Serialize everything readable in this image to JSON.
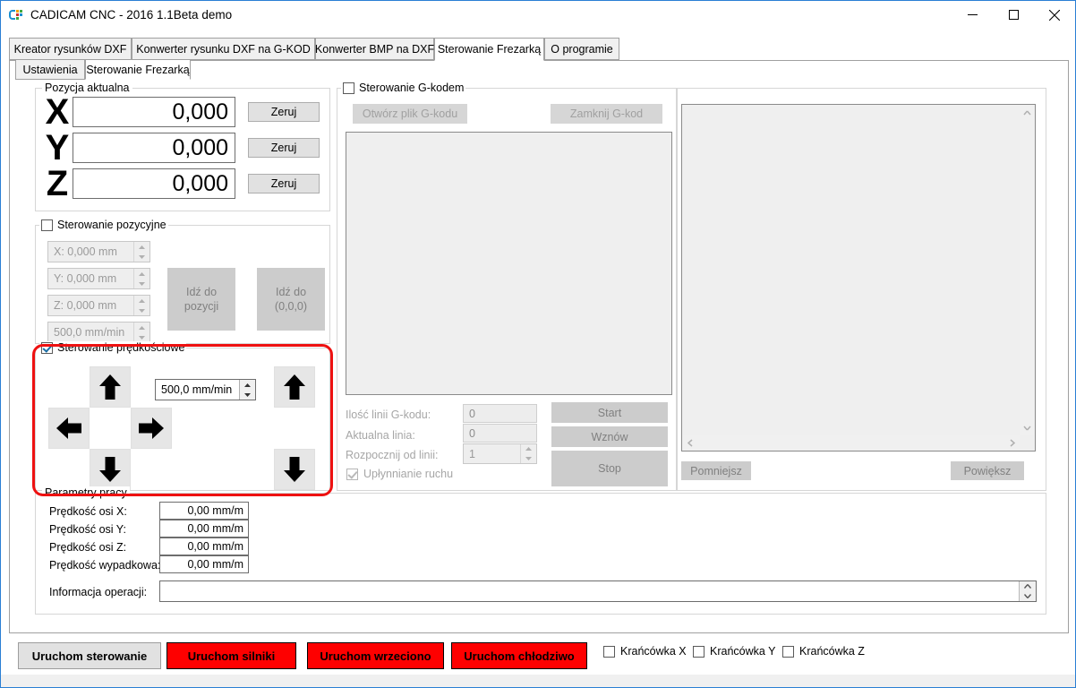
{
  "window": {
    "title": "CADICAM CNC - 2016 1.1Beta demo",
    "minimize": "minimize-icon",
    "maximize": "maximize-icon",
    "close": "close-icon"
  },
  "tabs": [
    {
      "label": "Kreator rysunków DXF",
      "active": false
    },
    {
      "label": "Konwerter rysunku DXF na G-KOD",
      "active": false
    },
    {
      "label": "Konwerter BMP na DXF",
      "active": false
    },
    {
      "label": "Sterowanie Frezarką",
      "active": true
    },
    {
      "label": "O programie",
      "active": false
    }
  ],
  "inner_tabs": [
    {
      "label": "Ustawienia",
      "active": false
    },
    {
      "label": "Sterowanie Frezarką",
      "active": true
    }
  ],
  "position_group": {
    "title": "Pozycja aktualna",
    "axes": [
      {
        "letter": "X",
        "value": "0,000",
        "zero_button": "Zeruj"
      },
      {
        "letter": "Y",
        "value": "0,000",
        "zero_button": "Zeruj"
      },
      {
        "letter": "Z",
        "value": "0,000",
        "zero_button": "Zeruj"
      }
    ]
  },
  "positional_control": {
    "title": "Sterowanie pozycyjne",
    "enabled": false,
    "fields": [
      {
        "value": "X: 0,000 mm"
      },
      {
        "value": "Y: 0,000 mm"
      },
      {
        "value": "Z: 0,000 mm"
      },
      {
        "value": "500,0 mm/min"
      }
    ],
    "goto_position_button": "Idź do\npozycji",
    "goto_position_line1": "Idź do",
    "goto_position_line2": "pozycji",
    "goto_zero_line1": "Idź do",
    "goto_zero_line2": "(0,0,0)"
  },
  "speed_control": {
    "title": "Sterowanie prędkościowe",
    "enabled": true,
    "feedrate": "500,0 mm/min",
    "highlighted": true,
    "highlight_color": "#ee1111",
    "buttons": [
      {
        "name": "jog-y-plus",
        "icon": "arrow-up-icon"
      },
      {
        "name": "jog-x-minus",
        "icon": "arrow-left-icon"
      },
      {
        "name": "jog-x-plus",
        "icon": "arrow-right-icon"
      },
      {
        "name": "jog-y-minus",
        "icon": "arrow-down-icon"
      },
      {
        "name": "jog-z-plus",
        "icon": "arrow-up-icon"
      },
      {
        "name": "jog-z-minus",
        "icon": "arrow-down-icon"
      }
    ]
  },
  "work_params": {
    "title": "Parametry pracy",
    "rows": [
      {
        "label": "Prędkość osi X:",
        "value": "0,00 mm/m"
      },
      {
        "label": "Prędkość osi Y:",
        "value": "0,00 mm/m"
      },
      {
        "label": "Prędkość osi Z:",
        "value": "0,00 mm/m"
      },
      {
        "label": "Prędkość wypadkowa:",
        "value": "0,00 mm/m"
      }
    ],
    "info_label": "Informacja operacji:",
    "info_value": ""
  },
  "gcode_control": {
    "title": "Sterowanie G-kodem",
    "enabled": false,
    "open_button": "Otwórz plik G-kodu",
    "close_button": "Zamknij G-kod",
    "editor_text": "",
    "lines_label": "Ilość linii G-kodu:",
    "lines_value": "0",
    "current_line_label": "Aktualna linia:",
    "current_line_value": "0",
    "start_from_label": "Rozpocznij od linii:",
    "start_from_value": "1",
    "smoothing_label": "Upłynnianie ruchu",
    "smoothing_checked": true,
    "start_button": "Start",
    "resume_button": "Wznów",
    "stop_button": "Stop"
  },
  "preview": {
    "zoom_out_button": "Pomniejsz",
    "zoom_in_button": "Powiększ"
  },
  "bottom_bar": {
    "buttons": [
      {
        "label": "Uruchom sterowanie",
        "style": "grey"
      },
      {
        "label": "Uruchom silniki",
        "style": "red"
      },
      {
        "label": "Uruchom wrzeciono",
        "style": "red"
      },
      {
        "label": "Uruchom chłodziwo",
        "style": "red"
      }
    ],
    "limit_switches": [
      {
        "label": "Krańcówka X",
        "checked": false
      },
      {
        "label": "Krańcówka Y",
        "checked": false
      },
      {
        "label": "Krańcówka Z",
        "checked": false
      }
    ]
  }
}
